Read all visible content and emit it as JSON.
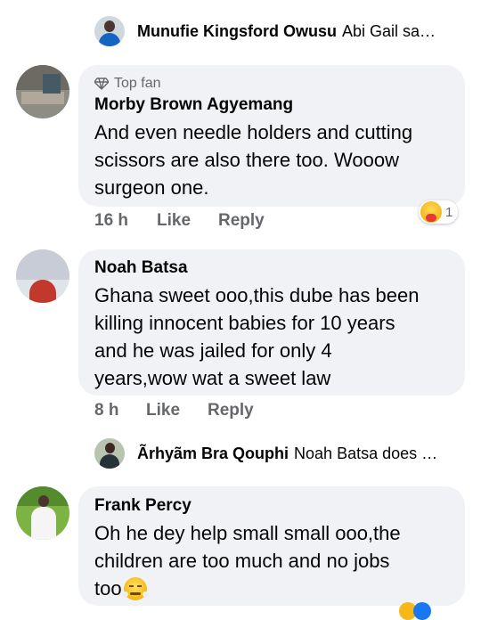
{
  "replies": [
    {
      "name": "Munufie Kingsford Owusu",
      "snippet": "Abi Gail sa…"
    },
    {
      "name": "Ãrhyãm Bra Qouphi",
      "snippet": "Noah Batsa does …"
    }
  ],
  "comments": [
    {
      "badge": "Top fan",
      "name": "Morby Brown Agyemang",
      "text_lines": [
        "And even needle holders and cutting",
        "scissors are also there too. Wooow",
        "surgeon one."
      ],
      "time": "16 h",
      "like": "Like",
      "reply": "Reply",
      "reaction_count": "1"
    },
    {
      "name": "Noah Batsa",
      "text_lines": [
        "Ghana sweet ooo,this dube has been",
        "killing innocent babies for 10 years",
        "and he was jailed for only 4",
        "years,wow wat a sweet law"
      ],
      "time": "8 h",
      "like": "Like",
      "reply": "Reply"
    },
    {
      "name": "Frank Percy",
      "text_lines": [
        "Oh he dey help small small ooo,the",
        "children are too much and no jobs",
        "too"
      ]
    }
  ],
  "icons": {
    "badge": "diamond-icon",
    "care_reaction": "care-emoji-icon",
    "frustrated_emoji": "steam-nose-emoji-icon"
  },
  "colors": {
    "bubble": "#f0f2f5",
    "meta": "#65676b",
    "like_blue": "#1877f2"
  }
}
